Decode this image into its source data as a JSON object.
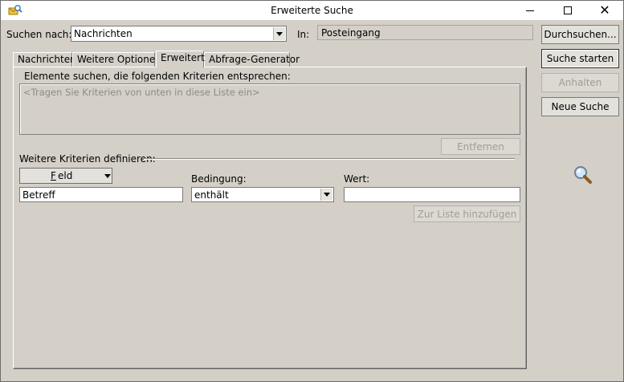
{
  "window": {
    "title": "Erweiterte Suche"
  },
  "search_bar": {
    "search_for_label": "Suchen nach:",
    "search_for_value": "Nachrichten",
    "in_label": "In:",
    "in_value": "Posteingang"
  },
  "tabs": [
    {
      "label": "Nachrichten",
      "active": false
    },
    {
      "label": "Weitere Optionen",
      "active": false
    },
    {
      "label": "Erweitert",
      "active": true
    },
    {
      "label": "Abfrage-Generator",
      "active": false
    }
  ],
  "advanced": {
    "criteria_heading": "Elemente suchen, die folgenden Kriterien entsprechen:",
    "criteria_placeholder": "<Tragen Sie Kriterien von unten in diese Liste ein>",
    "remove_button": "Entfernen",
    "define_more_label": "Weitere Kriterien definieren:",
    "field_button_first": "F",
    "field_button_rest": "eld",
    "field_value": "Betreff",
    "condition_label": "Bedingung:",
    "condition_value": "enthält",
    "value_label": "Wert:",
    "value_value": "",
    "add_to_list_button": "Zur Liste hinzufügen"
  },
  "side_buttons": {
    "browse": "Durchsuchen...",
    "start_search": "Suche starten",
    "stop": "Anhalten",
    "new_search": "Neue Suche"
  },
  "icons": {
    "app": "outlook-search-app-icon",
    "magnifier": "magnifier-icon"
  }
}
